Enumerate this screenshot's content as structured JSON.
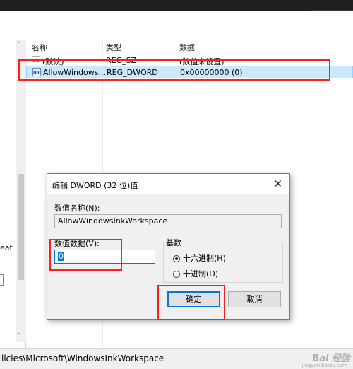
{
  "list": {
    "columns": [
      "名称",
      "类型",
      "数据"
    ],
    "rows": [
      {
        "name": "(默认)",
        "type": "REG_SZ",
        "data": "(数值未设置)"
      },
      {
        "name": "AllowWindows...",
        "type": "REG_DWORD",
        "data": "0x00000000 (0)"
      }
    ]
  },
  "left_pane": {
    "cut_text": "eat F"
  },
  "status_bar": {
    "path": "licies\\Microsoft\\WindowsInkWorkspace",
    "watermark": "Bai 经验",
    "watermark_sub": "jingyan.baidu.com"
  },
  "dialog": {
    "title": "编辑 DWORD (32 位)值",
    "value_name_label": "数值名称(N):",
    "value_name": "AllowWindowsInkWorkspace",
    "value_data_label": "数值数据(V):",
    "value_data": "0",
    "base_label": "基数",
    "radio_hex": "十六进制(H)",
    "radio_dec": "十进制(D)",
    "base_selected": "hex",
    "ok_label": "确定",
    "cancel_label": "取消"
  },
  "colors": {
    "highlight": "#ff1f1f",
    "selection": "#cce8ff",
    "accent": "#0078d7"
  }
}
